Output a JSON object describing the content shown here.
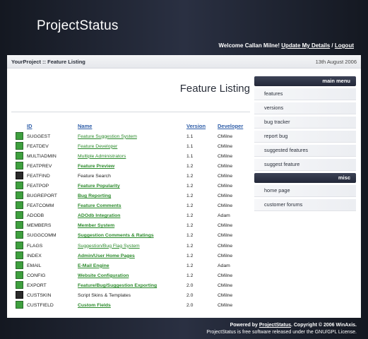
{
  "header": {
    "logo": "ProjectStatus",
    "welcome": "Welcome Callan Milne!",
    "update_details": "Update My Details",
    "separator": "/",
    "logout": "Logout"
  },
  "crumb": {
    "breadcrumb": "YourProject :: Feature Listing",
    "date": "13th August 2006"
  },
  "main": {
    "title": "Feature Listing",
    "columns": {
      "id": "ID",
      "name": "Name",
      "version": "Version",
      "developer": "Developer"
    },
    "rows": [
      {
        "id": "SUGGEST",
        "name": "Feature Suggestion System",
        "version": "1.1",
        "developer": "CMilne",
        "status": "green",
        "style": "link"
      },
      {
        "id": "FEATDEV",
        "name": "Feature Developer",
        "version": "1.1",
        "developer": "CMilne",
        "status": "green",
        "style": "link"
      },
      {
        "id": "MULTIADMIN",
        "name": "Multiple Administrators",
        "version": "1.1",
        "developer": "CMilne",
        "status": "green",
        "style": "link"
      },
      {
        "id": "FEATPREV",
        "name": "Feature Preview",
        "version": "1.2",
        "developer": "CMilne",
        "status": "green",
        "style": "bold"
      },
      {
        "id": "FEATFIND",
        "name": "Feature Search",
        "version": "1.2",
        "developer": "CMilne",
        "status": "dark",
        "style": "plain"
      },
      {
        "id": "FEATPOP",
        "name": "Feature Popularity",
        "version": "1.2",
        "developer": "CMilne",
        "status": "green",
        "style": "bold"
      },
      {
        "id": "BUGREPORT",
        "name": "Bug Reporting",
        "version": "1.2",
        "developer": "CMilne",
        "status": "green",
        "style": "bold"
      },
      {
        "id": "FEATCOMM",
        "name": "Feature Comments",
        "version": "1.2",
        "developer": "CMilne",
        "status": "green",
        "style": "bold"
      },
      {
        "id": "ADODB",
        "name": "ADOdb Integration",
        "version": "1.2",
        "developer": "Adam",
        "status": "green",
        "style": "bold"
      },
      {
        "id": "MEMBERS",
        "name": "Member System",
        "version": "1.2",
        "developer": "CMilne",
        "status": "green",
        "style": "bold"
      },
      {
        "id": "SUGGCOMM",
        "name": "Suggestion Comments & Ratings",
        "version": "1.2",
        "developer": "CMilne",
        "status": "green",
        "style": "bold"
      },
      {
        "id": "FLAGS",
        "name": "Suggestion/Bug Flag System",
        "version": "1.2",
        "developer": "CMilne",
        "status": "green",
        "style": "link"
      },
      {
        "id": "INDEX",
        "name": "Admin/User Home Pages",
        "version": "1.2",
        "developer": "CMilne",
        "status": "green",
        "style": "bold"
      },
      {
        "id": "EMAIL",
        "name": "E-Mail Engine",
        "version": "1.2",
        "developer": "Adam",
        "status": "green",
        "style": "bold"
      },
      {
        "id": "CONFIG",
        "name": "Website Configuration",
        "version": "1.2",
        "developer": "CMilne",
        "status": "green",
        "style": "bold"
      },
      {
        "id": "EXPORT",
        "name": "Feature/Bug/Suggestion Exporting",
        "version": "2.0",
        "developer": "CMilne",
        "status": "green",
        "style": "bold"
      },
      {
        "id": "CUSTSKIN",
        "name": "Script Skins & Templates",
        "version": "2.0",
        "developer": "CMilne",
        "status": "dark",
        "style": "plain"
      },
      {
        "id": "CUSTFIELD",
        "name": "Custom Fields",
        "version": "2.0",
        "developer": "CMilne",
        "status": "green",
        "style": "bold"
      }
    ]
  },
  "sidebar": {
    "main_menu_title": "main menu",
    "main_items": [
      "features",
      "versions",
      "bug tracker",
      "report bug",
      "suggested features",
      "suggest feature"
    ],
    "misc_title": "misc",
    "misc_items": [
      "home page",
      "customer forums"
    ]
  },
  "footer": {
    "powered_prefix": "Powered by",
    "powered_link": "ProjectStatus",
    "copyright": ". Copyright © 2006 WinAxis.",
    "license": "ProjectStatus is free software released under the GNU/GPL License."
  },
  "colors": {
    "status_green": "#3e9f3e",
    "status_dark": "#2a2a2a",
    "link_green": "#2b8a2b",
    "header_link_blue": "#2e5da8"
  }
}
